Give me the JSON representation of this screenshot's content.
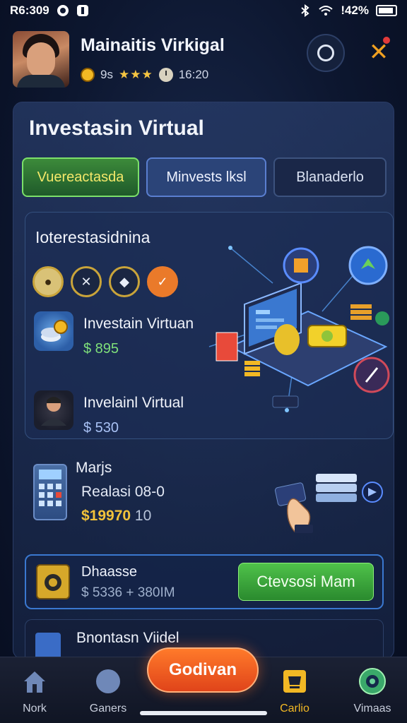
{
  "status_bar": {
    "time": "R6:309",
    "battery": "!42%"
  },
  "header": {
    "title": "Mainaitis Virkigal",
    "rating_text": "9s",
    "stars": "★★★",
    "time_text": "16:20"
  },
  "panel": {
    "title": "Investasin Virtual",
    "tabs": [
      "Vuereactasda",
      "Minvests lksl",
      "Blanaderlo"
    ]
  },
  "invest_card": {
    "title": "Ioterestasidnina",
    "items": [
      {
        "name": "Investain Virtuan",
        "amount": "$ 895"
      },
      {
        "name": "Invelainl Virtual",
        "amount": "$ 530"
      }
    ]
  },
  "marks_card": {
    "title": "Marjs",
    "subtitle": "Realasi 08-0",
    "amount": "$19970",
    "amount_rest": " 10"
  },
  "deposit_card": {
    "title": "Dhaasse",
    "amount": "$ 5336 + 380IM",
    "button": "Ctevsosi Mam"
  },
  "partial_card": {
    "title": "Bnontasn Viidel"
  },
  "bottom_nav": {
    "items": [
      "Nork",
      "Ganers",
      "Carlio",
      "Vimaas"
    ],
    "fab": "Godivan"
  },
  "colors": {
    "accent_green": "#4fc24a",
    "accent_orange": "#e0441a",
    "accent_gold": "#f2b824",
    "panel_bg": "#1c2c54"
  }
}
